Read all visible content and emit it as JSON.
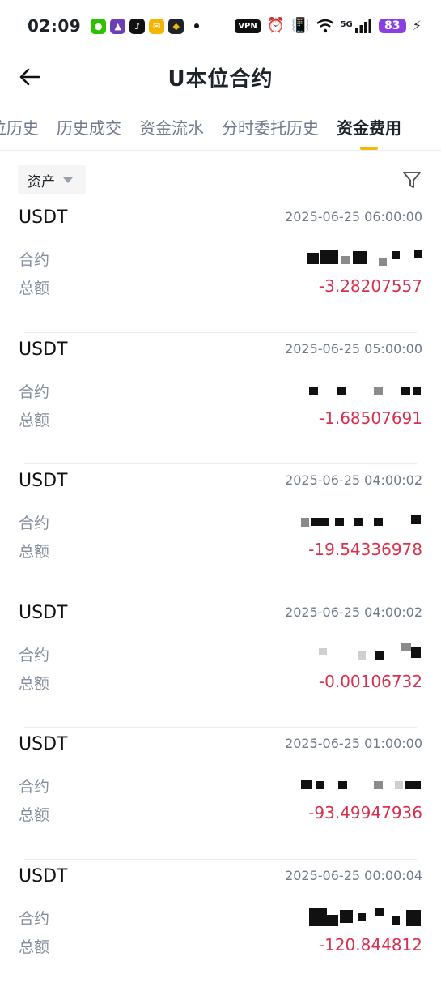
{
  "status_bar": {
    "time": "02:09",
    "vpn": "VPN",
    "network": "5G",
    "battery": "83",
    "apps": [
      {
        "name": "wechat-icon",
        "color": "#2dc100"
      },
      {
        "name": "game-icon",
        "color": "#6a3fb5"
      },
      {
        "name": "tiktok-icon",
        "color": "#111111"
      },
      {
        "name": "mail-icon",
        "color": "#f5b400"
      },
      {
        "name": "binance-icon",
        "color": "#1e2329"
      }
    ]
  },
  "header": {
    "title": "U本位合约"
  },
  "tabs": [
    {
      "label": "位历史",
      "active": false
    },
    {
      "label": "历史成交",
      "active": false
    },
    {
      "label": "资金流水",
      "active": false
    },
    {
      "label": "分时委托历史",
      "active": false
    },
    {
      "label": "资金费用",
      "active": true
    }
  ],
  "filter": {
    "asset_label": "资产"
  },
  "labels": {
    "contract": "合约",
    "total": "总额"
  },
  "records": [
    {
      "symbol": "USDT",
      "time": "2025-06-25 06:00:00",
      "amount": "-3.28207557"
    },
    {
      "symbol": "USDT",
      "time": "2025-06-25 05:00:00",
      "amount": "-1.68507691"
    },
    {
      "symbol": "USDT",
      "time": "2025-06-25 04:00:02",
      "amount": "-19.54336978"
    },
    {
      "symbol": "USDT",
      "time": "2025-06-25 04:00:02",
      "amount": "-0.00106732"
    },
    {
      "symbol": "USDT",
      "time": "2025-06-25 01:00:00",
      "amount": "-93.49947936"
    },
    {
      "symbol": "USDT",
      "time": "2025-06-25 00:00:04",
      "amount": "-120.844812"
    }
  ],
  "colors": {
    "accent": "#f0b90b",
    "negative": "#d9304e",
    "label": "#848e9c",
    "battery": "#8b3fe0"
  }
}
